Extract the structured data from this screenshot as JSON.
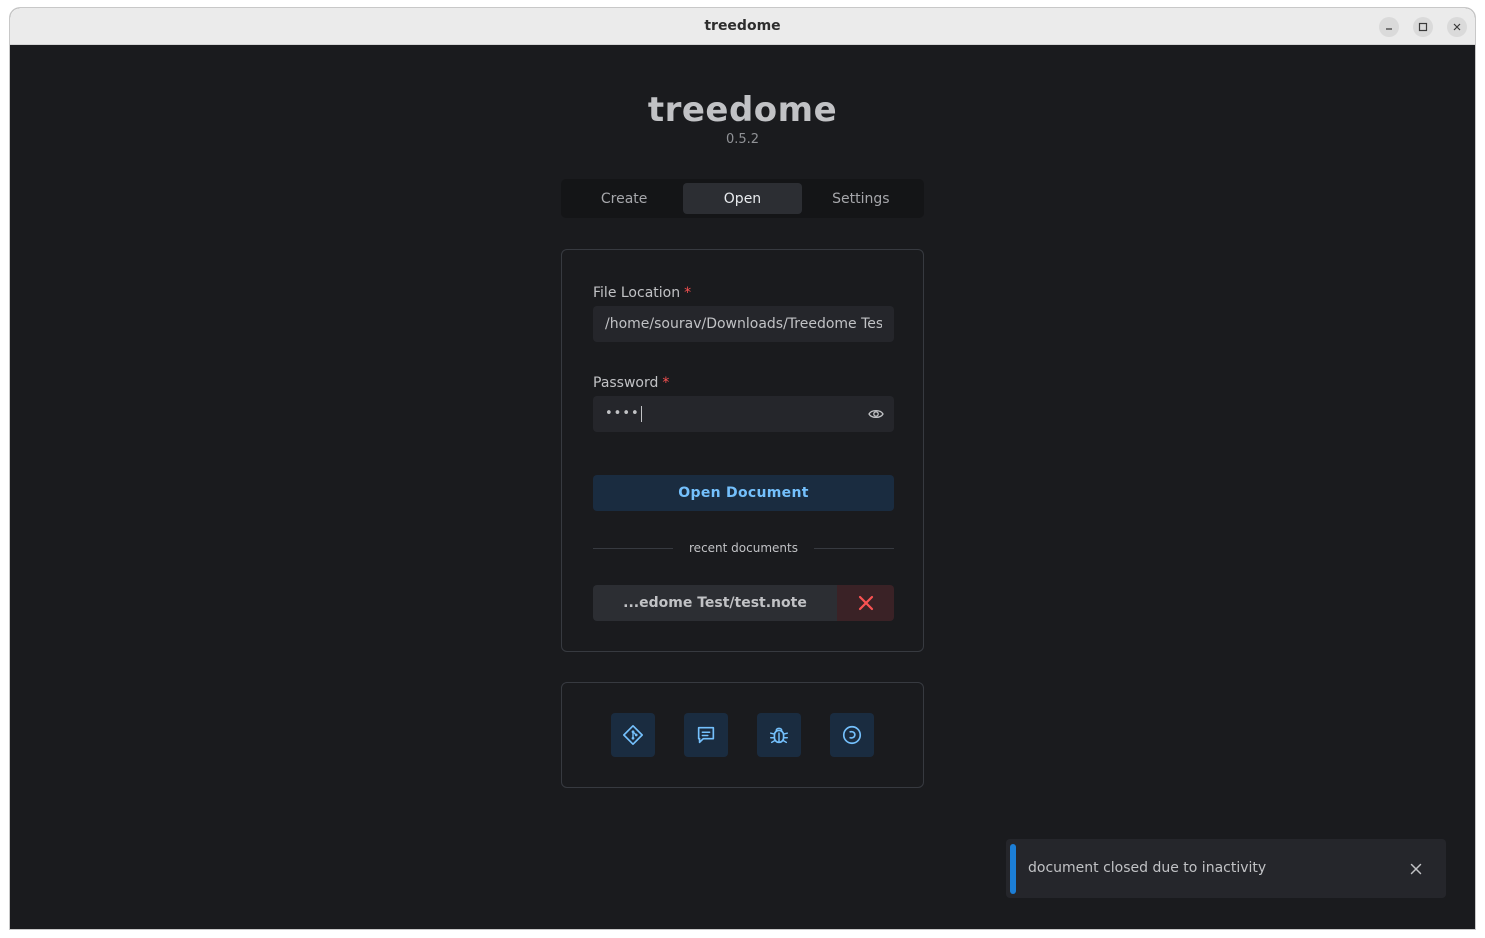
{
  "window": {
    "title": "treedome"
  },
  "app": {
    "name": "treedome",
    "version": "0.5.2"
  },
  "tabs": [
    {
      "label": "Create",
      "active": false
    },
    {
      "label": "Open",
      "active": true
    },
    {
      "label": "Settings",
      "active": false
    }
  ],
  "form": {
    "file_location_label": "File Location",
    "file_location_value": "/home/sourav/Downloads/Treedome Test/test.note",
    "password_label": "Password",
    "password_mask": "••••",
    "required_mark": "*",
    "open_button": "Open Document"
  },
  "recent": {
    "heading": "recent documents",
    "items": [
      {
        "label": "...edome Test/test.note"
      }
    ]
  },
  "links": [
    {
      "icon": "git-icon"
    },
    {
      "icon": "chat-icon"
    },
    {
      "icon": "bug-icon"
    },
    {
      "icon": "donate-icon"
    }
  ],
  "toast": {
    "message": "document closed due to inactivity"
  },
  "colors": {
    "accent": "#74c0fc",
    "accent_bg": "#1a2c40",
    "danger": "#fa5252",
    "toast_bar": "#1c7ed6"
  }
}
